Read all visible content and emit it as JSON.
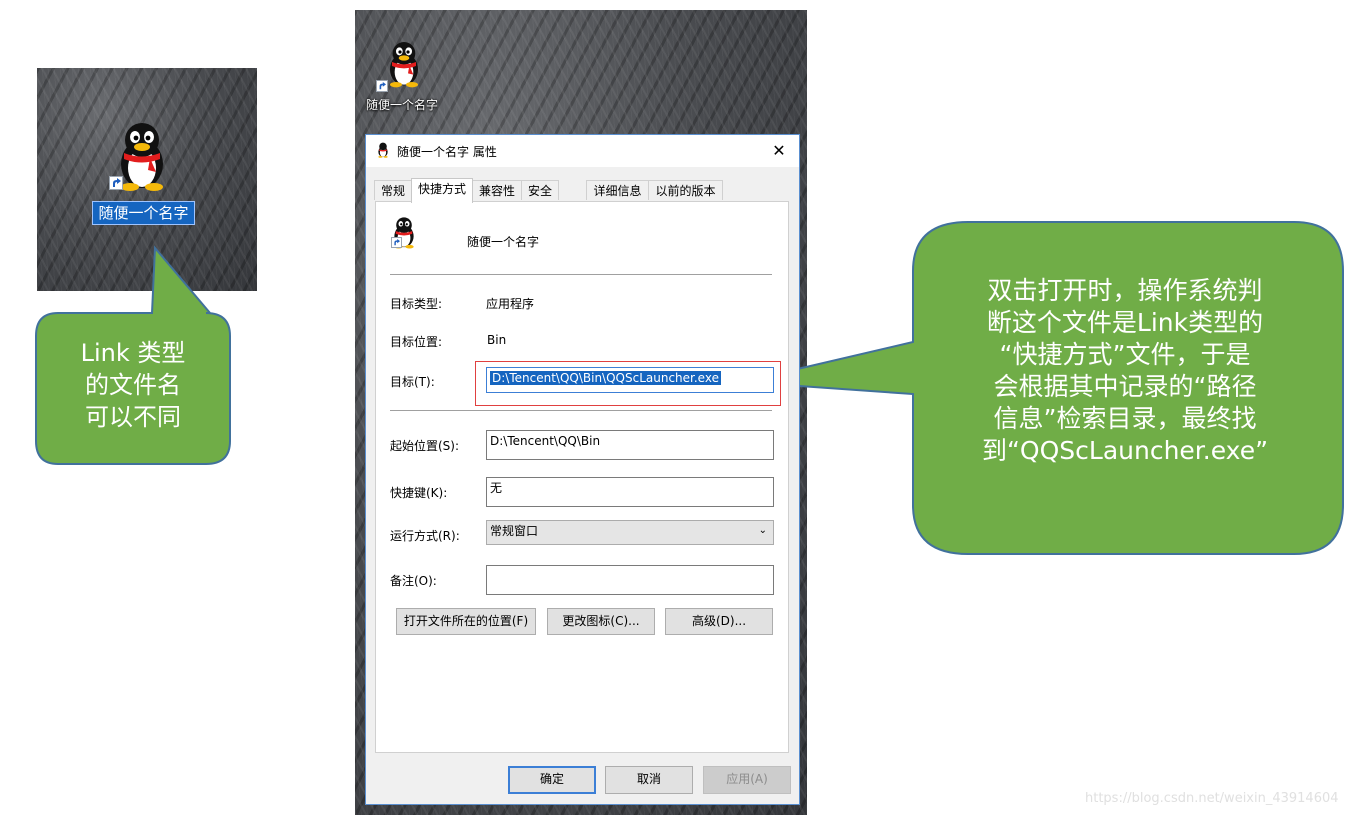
{
  "left_icon": {
    "label": "随便一个名字"
  },
  "desktop_icon": {
    "label": "随便一个名字"
  },
  "bubble_left": {
    "lines": [
      "Link 类型",
      "的文件名",
      "可以不同"
    ]
  },
  "bubble_right": {
    "lines": [
      "双击打开时，操作系统判",
      "断这个文件是Link类型的",
      "“快捷方式”文件，于是",
      "会根据其中记录的“路径",
      "信息”检索目录，最终找",
      "到“QQScLauncher.exe”"
    ]
  },
  "dialog": {
    "title": "随便一个名字 属性",
    "close": "✕",
    "tabs": [
      "常规",
      "快捷方式",
      "兼容性",
      "安全",
      "详细信息",
      "以前的版本"
    ],
    "active_tab": "快捷方式",
    "shortcut_name": "随便一个名字",
    "fields": {
      "target_type_label": "目标类型:",
      "target_type_value": "应用程序",
      "target_location_label": "目标位置:",
      "target_location_value": "Bin",
      "target_label": "目标(T):",
      "target_value": "D:\\Tencent\\QQ\\Bin\\QQScLauncher.exe",
      "start_in_label": "起始位置(S):",
      "start_in_value": "D:\\Tencent\\QQ\\Bin",
      "hotkey_label": "快捷键(K):",
      "hotkey_value": "无",
      "run_label": "运行方式(R):",
      "run_value": "常规窗口",
      "comment_label": "备注(O):",
      "comment_value": ""
    },
    "buttons": {
      "open_location": "打开文件所在的位置(F)",
      "change_icon": "更改图标(C)...",
      "advanced": "高级(D)...",
      "ok": "确定",
      "cancel": "取消",
      "apply": "应用(A)"
    }
  },
  "watermark": "https://blog.csdn.net/weixin_43914604",
  "colors": {
    "bubble_fill": "#70ad47",
    "bubble_stroke": "#41719c",
    "selection": "#1565c0"
  }
}
